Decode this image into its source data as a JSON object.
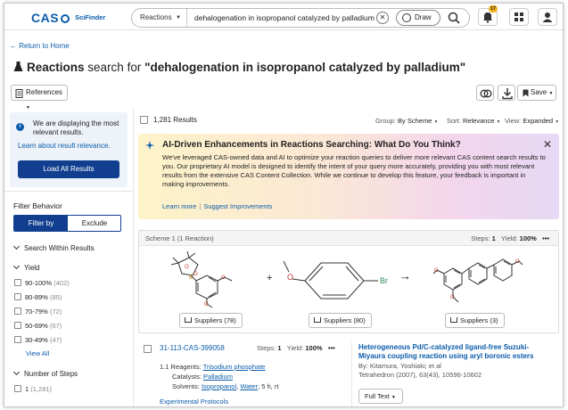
{
  "header": {
    "brand": "CAS",
    "product": "SciFinder",
    "search_scope": "Reactions",
    "search_query": "dehalogenation in isopropanol catalyzed by palladium",
    "draw_label": "Draw",
    "notification_count": "17"
  },
  "nav": {
    "back_label": "Return to Home"
  },
  "title": {
    "prefix": "Reactions",
    "middle": "search for",
    "query": "\"dehalogenation in isopropanol catalyzed by palladium\""
  },
  "toolbar": {
    "references_label": "References",
    "save_label": "Save"
  },
  "left_panel": {
    "relevance_msg": "We are displaying the most relevant results.",
    "relevance_link": "Learn about result relevance.",
    "load_all_label": "Load All Results",
    "filter_behavior_label": "Filter Behavior",
    "filter_by_label": "Filter by",
    "exclude_label": "Exclude",
    "search_within_label": "Search Within Results",
    "yield_label": "Yield",
    "yield_options": [
      {
        "label": "90-100%",
        "count": "(402)"
      },
      {
        "label": "80-89%",
        "count": "(85)"
      },
      {
        "label": "70-79%",
        "count": "(72)"
      },
      {
        "label": "50-69%",
        "count": "(67)"
      },
      {
        "label": "30-49%",
        "count": "(47)"
      }
    ],
    "view_all_label": "View All",
    "steps_label": "Number of Steps",
    "steps_options": [
      {
        "label": "1",
        "count": "(1,281)"
      }
    ]
  },
  "results": {
    "count_label": "1,281 Results",
    "group_label": "Group:",
    "group_value": "By Scheme",
    "sort_label": "Sort:",
    "sort_value": "Relevance",
    "view_label": "View:",
    "view_value": "Expanded"
  },
  "ai_banner": {
    "title": "AI-Driven Enhancements in Reactions Searching: What Do You Think?",
    "body": "We've leveraged CAS-owned data and AI to optimize your reaction queries to deliver more relevant CAS content search results to you. Our proprietary AI model is designed to identify the intent of your query more accurately, providing you with most relevant results from the extensive CAS Content Collection. While we continue to develop this feature, your feedback is important in making improvements.",
    "learn_more": "Learn more",
    "suggest": "Suggest Improvements"
  },
  "scheme": {
    "label": "Scheme 1",
    "reaction_count": "(1 Reaction)",
    "steps_label": "Steps:",
    "steps_value": "1",
    "yield_label": "Yield:",
    "yield_value": "100%",
    "plus": "+",
    "arrow": "→",
    "br_label": "Br",
    "o_label": "O",
    "suppliers": [
      "Suppliers (78)",
      "Suppliers (80)",
      "Suppliers (3)"
    ]
  },
  "reaction": {
    "id": "31-113-CAS-399058",
    "steps_label": "Steps:",
    "steps_value": "1",
    "yield_label": "Yield:",
    "yield_value": "100%",
    "step_number": "1.1",
    "reagents_label": "Reagents:",
    "reagent": "Trisodium phosphate",
    "catalysts_label": "Catalysts:",
    "catalyst": "Palladium",
    "solvents_label": "Solvents:",
    "solvent1": "Isopropanol",
    "solvent2": "Water",
    "conditions": "; 5 h, rt",
    "protocols_label": "Experimental Protocols"
  },
  "article": {
    "title": "Heterogeneous Pd/C-catalyzed ligand-free Suzuki-Miyaura coupling reaction using aryl boronic esters",
    "authors": "By: Kitamura, Yoshiaki; et al",
    "journal": "Tetrahedron (2007), 63(43), 10596-10602",
    "full_text_label": "Full Text"
  }
}
